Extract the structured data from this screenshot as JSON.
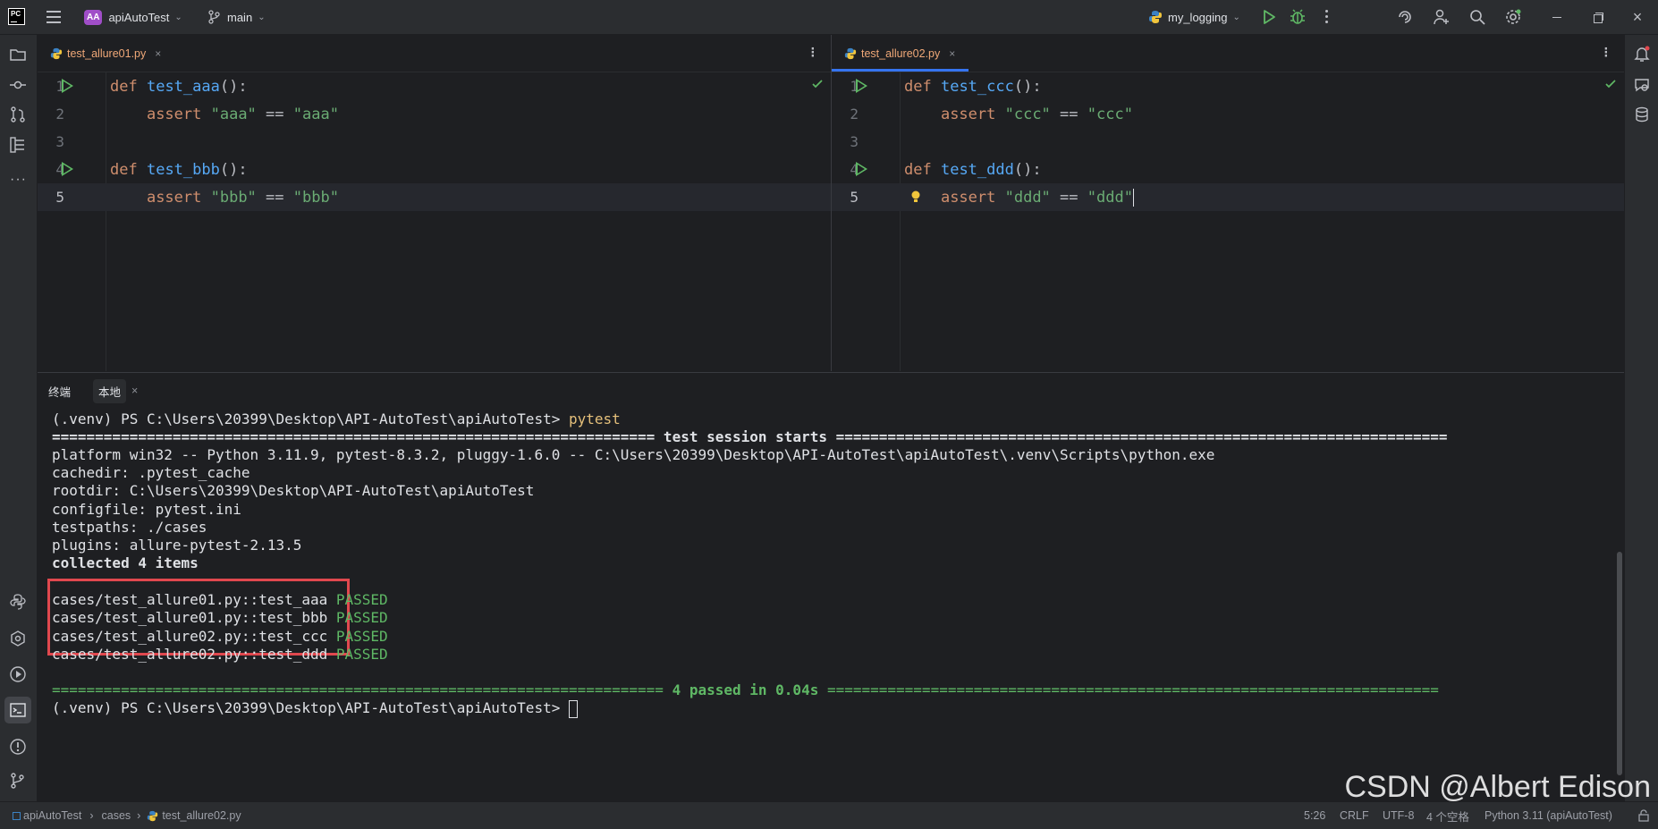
{
  "titlebar": {
    "app_badge": "PC",
    "project_badge": "AA",
    "project_name": "apiAutoTest",
    "branch": "main",
    "run_config": "my_logging"
  },
  "editors": [
    {
      "tab_label": "test_allure01.py",
      "lines": [
        {
          "num": "1",
          "kw": "def",
          "fn": "test_aaa",
          "rest": "():"
        },
        {
          "num": "2",
          "indent": "    ",
          "plain": "assert ",
          "s1": "\"aaa\"",
          "op": " == ",
          "s2": "\"aaa\""
        },
        {
          "num": "3"
        },
        {
          "num": "4",
          "kw": "def",
          "fn": "test_bbb",
          "rest": "():"
        },
        {
          "num": "5",
          "indent": "    ",
          "plain": "assert ",
          "s1": "\"bbb\"",
          "op": " == ",
          "s2": "\"bbb\""
        }
      ]
    },
    {
      "tab_label": "test_allure02.py",
      "lines": [
        {
          "num": "1",
          "kw": "def",
          "fn": "test_ccc",
          "rest": "():"
        },
        {
          "num": "2",
          "indent": "    ",
          "plain": "assert ",
          "s1": "\"ccc\"",
          "op": " == ",
          "s2": "\"ccc\""
        },
        {
          "num": "3"
        },
        {
          "num": "4",
          "kw": "def",
          "fn": "test_ddd",
          "rest": "():"
        },
        {
          "num": "5",
          "indent": "    ",
          "plain": "assert ",
          "s1": "\"ddd\"",
          "op": " == ",
          "s2": "\"ddd\""
        }
      ]
    }
  ],
  "terminal": {
    "tab_terminal": "终端",
    "tab_local": "本地",
    "prompt": "(.venv) PS C:\\Users\\20399\\Desktop\\API-AutoTest\\apiAutoTest>",
    "command": "pytest",
    "session_start_left": "======================================================================",
    "session_start_text": " test session starts ",
    "session_start_right": "=======================================================================",
    "platform": "platform win32 -- Python 3.11.9, pytest-8.3.2, pluggy-1.6.0 -- C:\\Users\\20399\\Desktop\\API-AutoTest\\apiAutoTest\\.venv\\Scripts\\python.exe",
    "cachedir": "cachedir: .pytest_cache",
    "rootdir": "rootdir: C:\\Users\\20399\\Desktop\\API-AutoTest\\apiAutoTest",
    "configfile": "configfile: pytest.ini",
    "testpaths": "testpaths: ./cases",
    "plugins": "plugins: allure-pytest-2.13.5",
    "collected": "collected 4 items",
    "results": [
      {
        "test": "cases/test_allure01.py::test_aaa",
        "status": "PASSED"
      },
      {
        "test": "cases/test_allure01.py::test_bbb",
        "status": "PASSED"
      },
      {
        "test": "cases/test_allure02.py::test_ccc",
        "status": "PASSED"
      },
      {
        "test": "cases/test_allure02.py::test_ddd",
        "status": "PASSED"
      }
    ],
    "summary_left": "=======================================================================",
    "summary_text": " 4 passed in 0.04s ",
    "summary_right": "=======================================================================",
    "final_prompt": "(.venv) PS C:\\Users\\20399\\Desktop\\API-AutoTest\\apiAutoTest>"
  },
  "statusbar": {
    "crumb1": "apiAutoTest",
    "crumb2": "cases",
    "crumb3": "test_allure02.py",
    "position": "5:26",
    "line_sep": "CRLF",
    "encoding": "UTF-8",
    "indent": "4 个空格",
    "interpreter": "Python 3.11 (apiAutoTest)"
  },
  "watermark": "CSDN @Albert Edison",
  "colors": {
    "accent": "#3574f0",
    "pass": "#5fb865",
    "highlight_box": "#e0484e",
    "tab_modified": "#f0a878"
  }
}
